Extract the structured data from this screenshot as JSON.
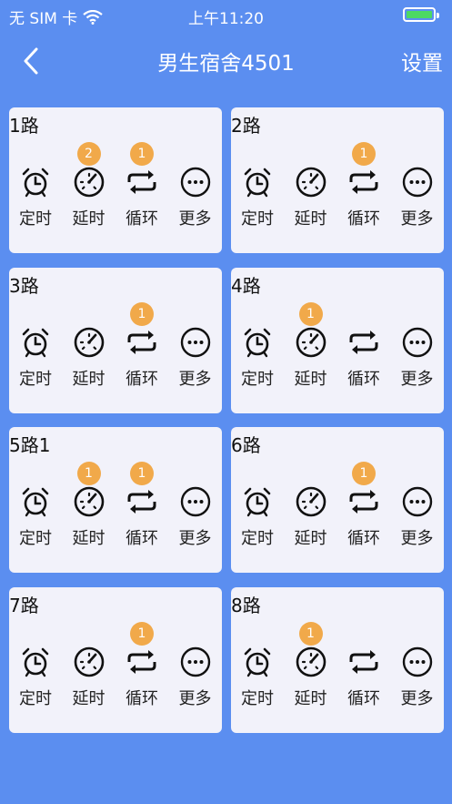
{
  "status": {
    "carrier": "无 SIM 卡",
    "time": "上午11:20"
  },
  "nav": {
    "title": "男生宿舍4501",
    "settings": "设置"
  },
  "labels": {
    "timer": "定时",
    "delay": "延时",
    "loop": "循环",
    "more": "更多"
  },
  "icons": {
    "timer": "alarm-clock-icon",
    "delay": "gauge-icon",
    "loop": "repeat-icon",
    "more": "more-icon"
  },
  "colors": {
    "background": "#5b8ef0",
    "card": "#f2f2fa",
    "badge": "#f1a94a",
    "battery": "#4cd964"
  },
  "cards": [
    {
      "name": "1路",
      "badges": {
        "timer": "",
        "delay": "2",
        "loop": "1",
        "more": ""
      }
    },
    {
      "name": "2路",
      "badges": {
        "timer": "",
        "delay": "",
        "loop": "1",
        "more": ""
      }
    },
    {
      "name": "3路",
      "badges": {
        "timer": "",
        "delay": "",
        "loop": "1",
        "more": ""
      }
    },
    {
      "name": "4路",
      "badges": {
        "timer": "",
        "delay": "1",
        "loop": "",
        "more": ""
      }
    },
    {
      "name": "5路1",
      "badges": {
        "timer": "",
        "delay": "1",
        "loop": "1",
        "more": ""
      }
    },
    {
      "name": "6路",
      "badges": {
        "timer": "",
        "delay": "",
        "loop": "1",
        "more": ""
      }
    },
    {
      "name": "7路",
      "badges": {
        "timer": "",
        "delay": "",
        "loop": "1",
        "more": ""
      }
    },
    {
      "name": "8路",
      "badges": {
        "timer": "",
        "delay": "1",
        "loop": "",
        "more": ""
      }
    }
  ]
}
